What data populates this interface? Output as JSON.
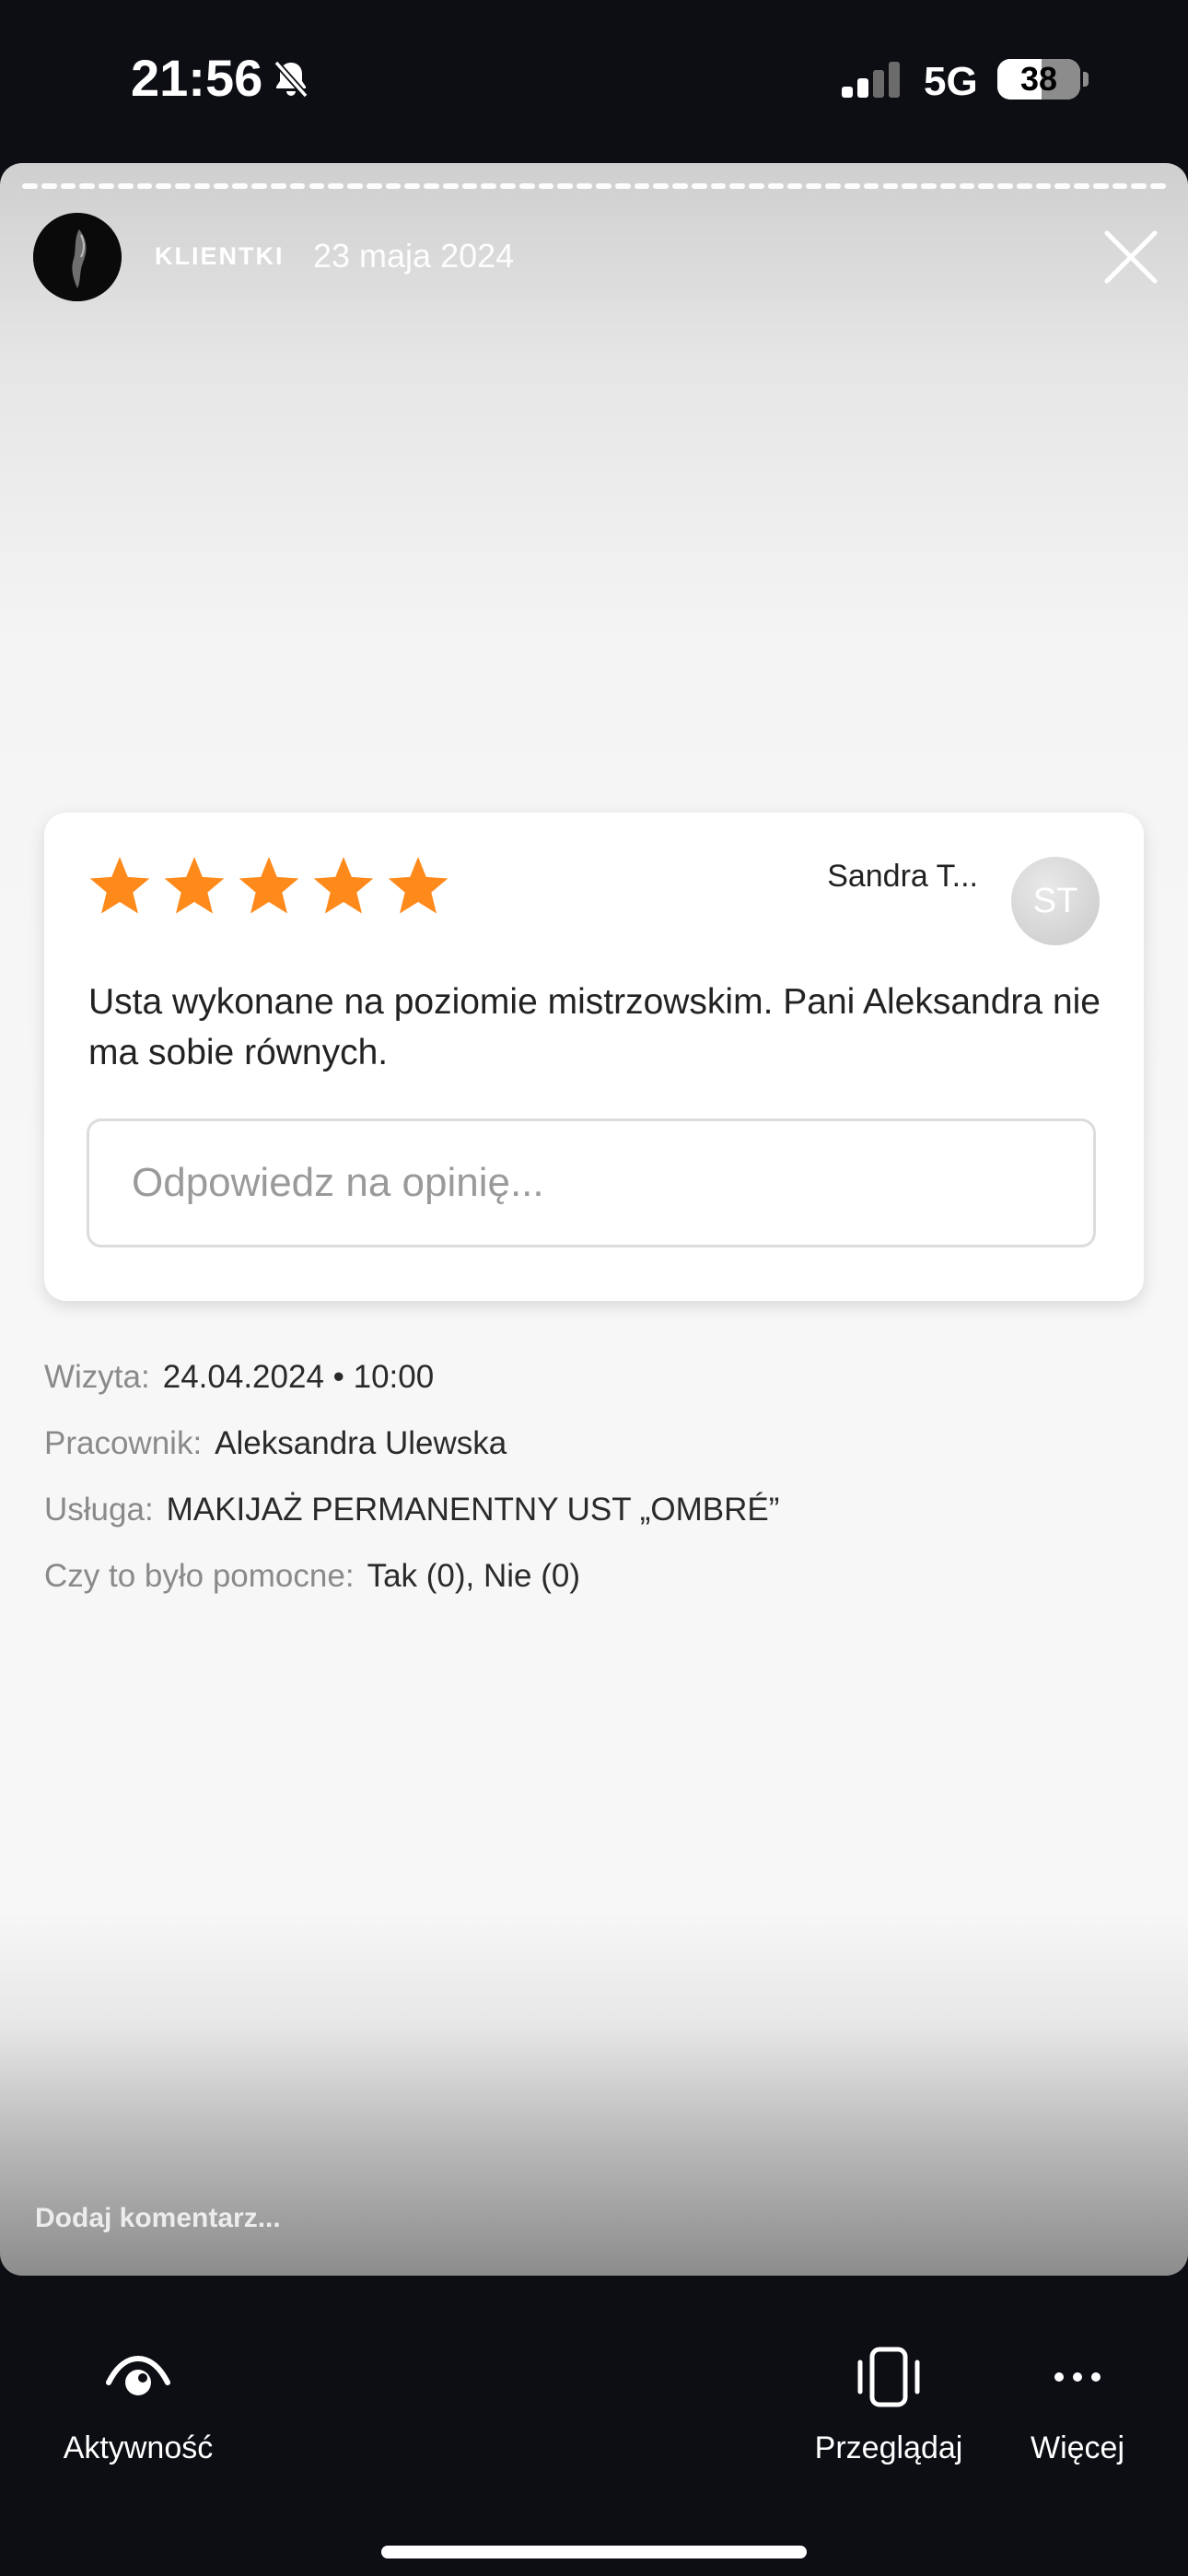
{
  "status_bar": {
    "time": "21:56",
    "network": "5G",
    "battery": "38",
    "battery_level": 0.38,
    "signal_bars_active": 2,
    "signal_bars_total": 4,
    "icons": [
      "bell-slash-icon",
      "signal-icon",
      "battery-icon"
    ]
  },
  "story": {
    "account_name": "KLIENTKI",
    "date": "23 maja 2024",
    "progress_segments_total": 60,
    "progress_segments_seen": 1,
    "close_icon": "close-icon",
    "comment_placeholder": "Dodaj komentarz..."
  },
  "review": {
    "rating": 5,
    "rating_max": 5,
    "star_color": "#ff8a1c",
    "reviewer_name": "Sandra T...",
    "reviewer_initials": "ST",
    "text": "Usta wykonane na poziomie mistrzowskim. Pani Aleksandra nie ma sobie równych.",
    "reply_placeholder": "Odpowiedz na opinię..."
  },
  "meta": {
    "visit_label": "Wizyta:",
    "visit_value": "24.04.2024 • 10:00",
    "employee_label": "Pracownik:",
    "employee_value": "Aleksandra Ulewska",
    "service_label": "Usługa:",
    "service_value": "MAKIJAŻ PERMANENTNY UST „OMBRÉ”",
    "helpful_label": "Czy to było pomocne:",
    "helpful_value": "Tak (0), Nie (0)"
  },
  "bottom_bar": {
    "activity_label": "Aktywność",
    "browse_label": "Przeglądaj",
    "more_label": "Więcej",
    "icons": [
      "activity-eye-icon",
      "browse-phone-icon",
      "more-dots-icon"
    ]
  }
}
